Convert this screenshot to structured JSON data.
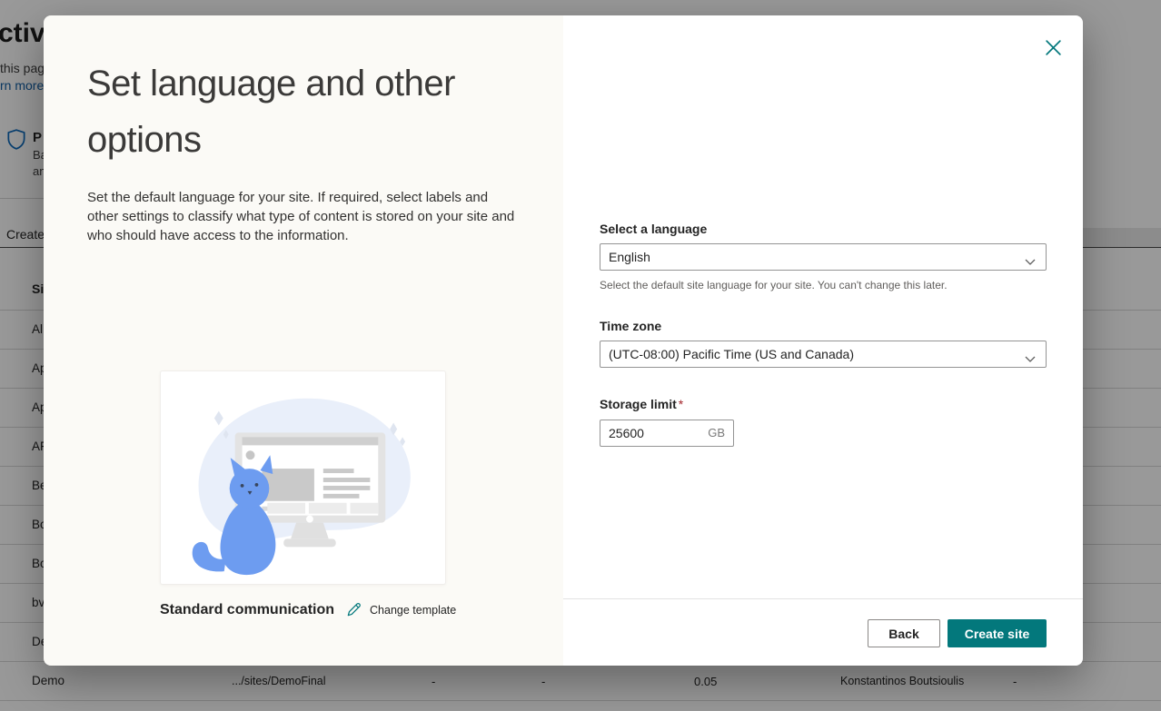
{
  "background": {
    "page_title_fragment": "ctive",
    "intro_fragment": "this pag",
    "link_fragment": "rn more",
    "banner": {
      "title_fragment": "P",
      "line1_fragment": "Ba",
      "line2_fragment": "an"
    },
    "toolbar": {
      "create_label": "Create"
    },
    "table": {
      "header_fragment": "Si",
      "row_fragments": [
        "Al",
        "Ap",
        "Ap",
        "AF",
        "Be",
        "Bo",
        "Bo",
        "bv",
        "De"
      ],
      "bottom_row": {
        "name": "Demo",
        "url": ".../sites/DemoFinal",
        "col3": "-",
        "col4": "-",
        "storage_used": "0.05",
        "owner": "Konstantinos Boutsioulis",
        "col7": "-"
      }
    }
  },
  "dialog": {
    "title": "Set language and other options",
    "description": "Set the default language for your site. If required, select labels and other settings to classify what type of content is stored on your site and who should have access to the information.",
    "template": {
      "name": "Standard communication",
      "change_label": "Change template",
      "illustration": "cat-and-monitor-illustration"
    },
    "form": {
      "language": {
        "label": "Select a language",
        "value": "English",
        "helper": "Select the default site language for your site. You can't change this later."
      },
      "timezone": {
        "label": "Time zone",
        "value": "(UTC-08:00) Pacific Time (US and Canada)"
      },
      "storage": {
        "label": "Storage limit",
        "required_marker": "*",
        "value": "25600",
        "unit": "GB"
      }
    },
    "footer": {
      "back_label": "Back",
      "create_label": "Create site"
    }
  },
  "colors": {
    "accent_teal": "#03787c",
    "link_blue": "#115ea3",
    "required_red": "#a4262c",
    "cat_blue": "#6d9cf0",
    "shield_blue": "#0f6cbd"
  }
}
